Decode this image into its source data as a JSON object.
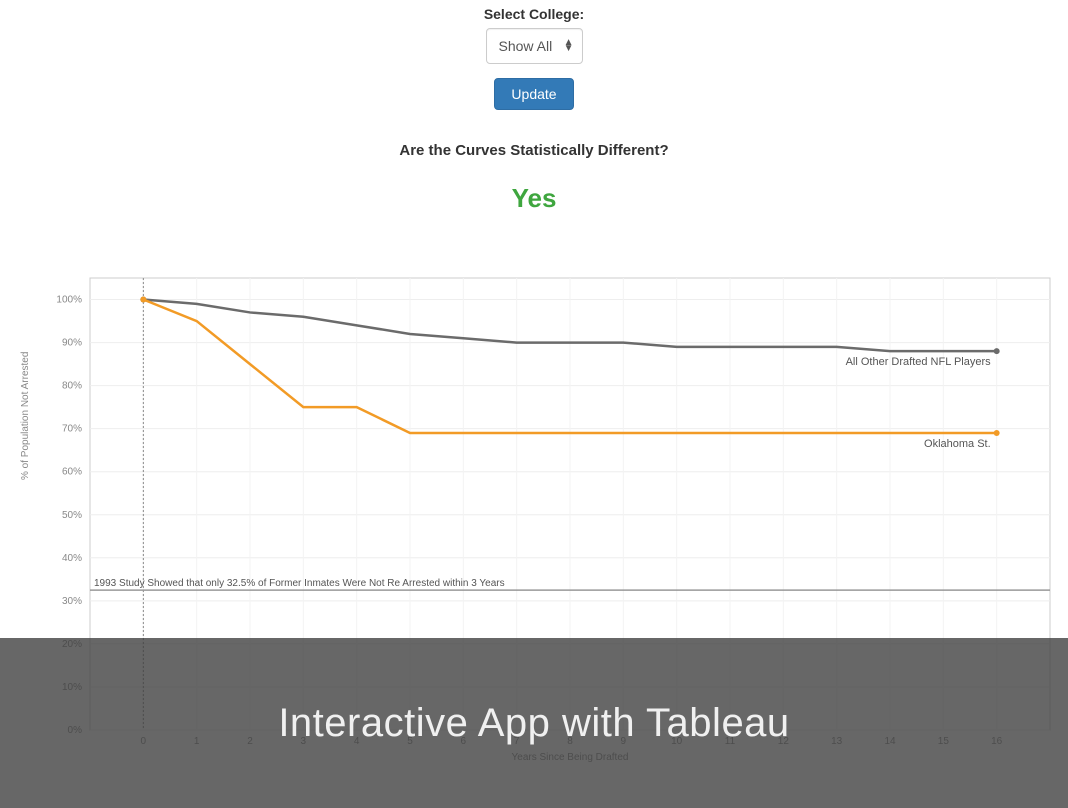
{
  "controls": {
    "label": "Select College:",
    "selected": "Show All",
    "button": "Update"
  },
  "question": "Are the Curves Statistically Different?",
  "answer": "Yes",
  "overlay": "Interactive App with Tableau",
  "chart_data": {
    "type": "line",
    "title": "",
    "xlabel": "Years Since Being Drafted",
    "ylabel": "% of Population Not Arrested",
    "xlim": [
      -1,
      17
    ],
    "ylim": [
      0,
      105
    ],
    "y_ticks": [
      0,
      10,
      20,
      30,
      40,
      50,
      60,
      70,
      80,
      90,
      100
    ],
    "y_tick_labels": [
      "0%",
      "10%",
      "20%",
      "30%",
      "40%",
      "50%",
      "60%",
      "70%",
      "80%",
      "90%",
      "100%"
    ],
    "x_ticks": [
      0,
      1,
      2,
      3,
      4,
      5,
      6,
      7,
      8,
      9,
      10,
      11,
      12,
      13,
      14,
      15,
      16
    ],
    "x": [
      0,
      1,
      2,
      3,
      4,
      5,
      6,
      7,
      8,
      9,
      10,
      11,
      12,
      13,
      14,
      15,
      16
    ],
    "series": [
      {
        "name": "All Other Drafted NFL Players",
        "color": "#6b6b6b",
        "values": [
          100,
          99,
          97,
          96,
          94,
          92,
          91,
          90,
          90,
          90,
          89,
          89,
          89,
          89,
          88,
          88,
          88
        ]
      },
      {
        "name": "Oklahoma St.",
        "color": "#f29b26",
        "values": [
          100,
          95,
          85,
          75,
          75,
          69,
          69,
          69,
          69,
          69,
          69,
          69,
          69,
          69,
          69,
          69,
          69
        ]
      }
    ],
    "reference_line": {
      "y": 32.5,
      "label": "1993 Study Showed that only 32.5% of Former Inmates Were Not Re Arrested within 3 Years"
    }
  }
}
